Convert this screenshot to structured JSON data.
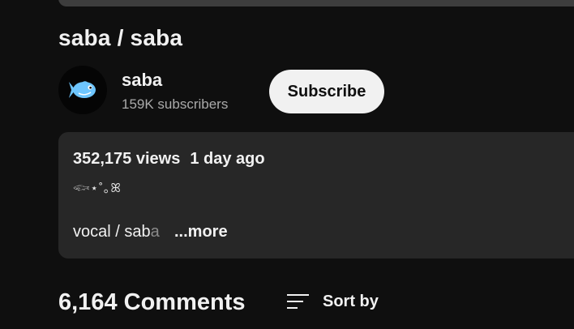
{
  "video": {
    "title": "saba / saba"
  },
  "channel": {
    "name": "saba",
    "subscribers": "159K subscribers",
    "avatar_icon": "fish-icon",
    "subscribe_label": "Subscribe"
  },
  "description": {
    "views": "352,175 views",
    "age": "1 day ago",
    "emoji_line": "𓆟⋆˚｡ꕤ",
    "snippet_visible": "vocal / sab",
    "snippet_faded": "a",
    "more_label": "...more"
  },
  "comments": {
    "count_label": "6,164 Comments",
    "sort_label": "Sort by",
    "sort_icon": "sort-icon"
  },
  "colors": {
    "background": "#0f0f0f",
    "description_bg": "#272727",
    "subscribe_bg": "#f1f1f1",
    "secondary_text": "#aaaaaa",
    "fish_blue": "#6ec6ff"
  }
}
